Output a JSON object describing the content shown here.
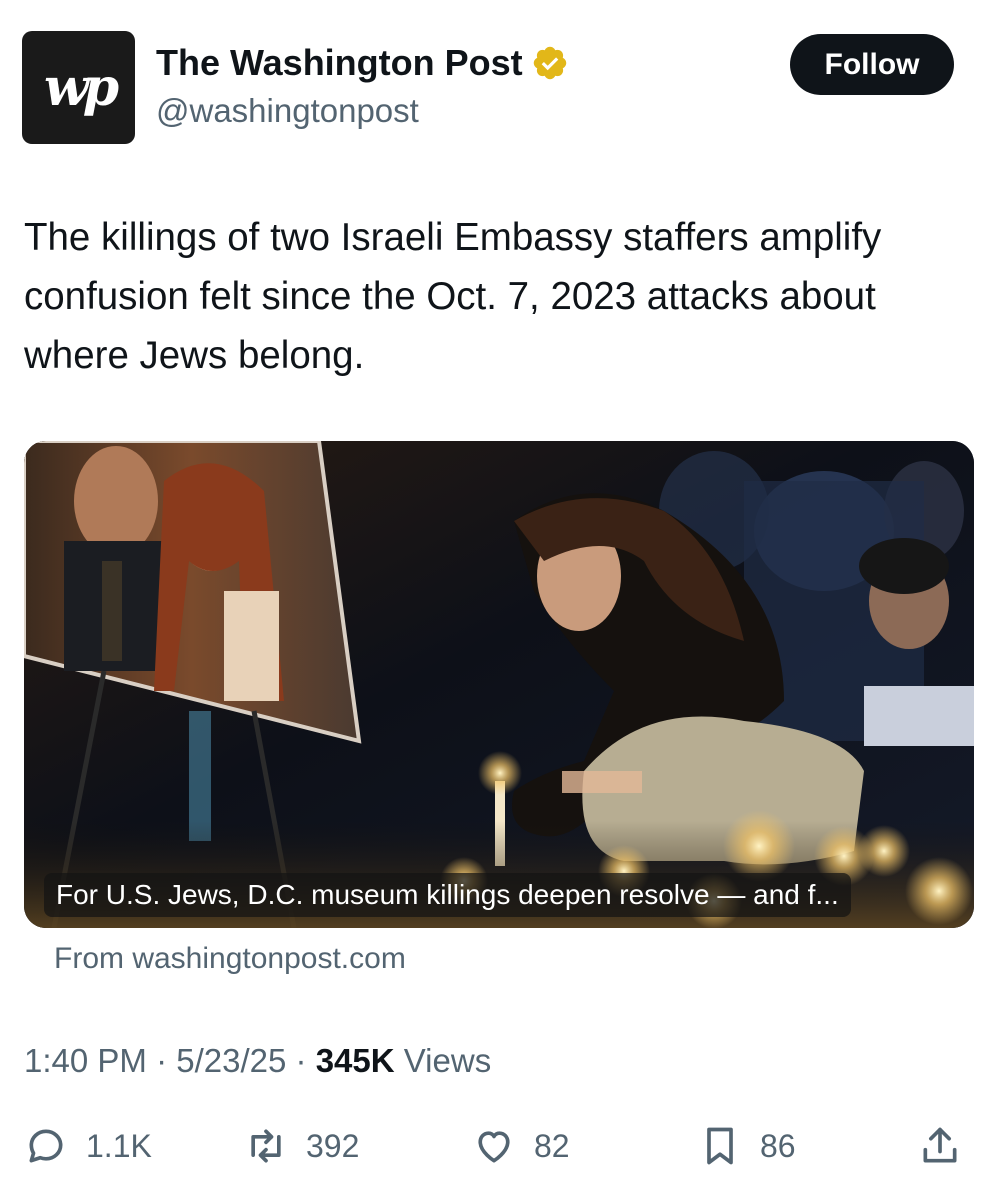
{
  "author": {
    "avatar_text": "wp",
    "name": "The Washington Post",
    "handle": "@washingtonpost",
    "verified": true,
    "verified_color": "#e2b719"
  },
  "follow_label": "Follow",
  "tweet_text": "The killings of two Israeli Embassy staffers amplify confusion felt since the Oct. 7, 2023 attacks about where Jews belong.",
  "card": {
    "caption": "For U.S. Jews, D.C. museum killings deepen resolve — and f...",
    "source": "From washingtonpost.com"
  },
  "meta": {
    "time": "1:40 PM",
    "date": "5/23/25",
    "views_count": "345K",
    "views_label": "Views"
  },
  "actions": {
    "replies": "1.1K",
    "reposts": "392",
    "likes": "82",
    "bookmarks": "86"
  },
  "colors": {
    "text": "#0f1419",
    "secondary": "#536471",
    "button_bg": "#0f1419"
  }
}
